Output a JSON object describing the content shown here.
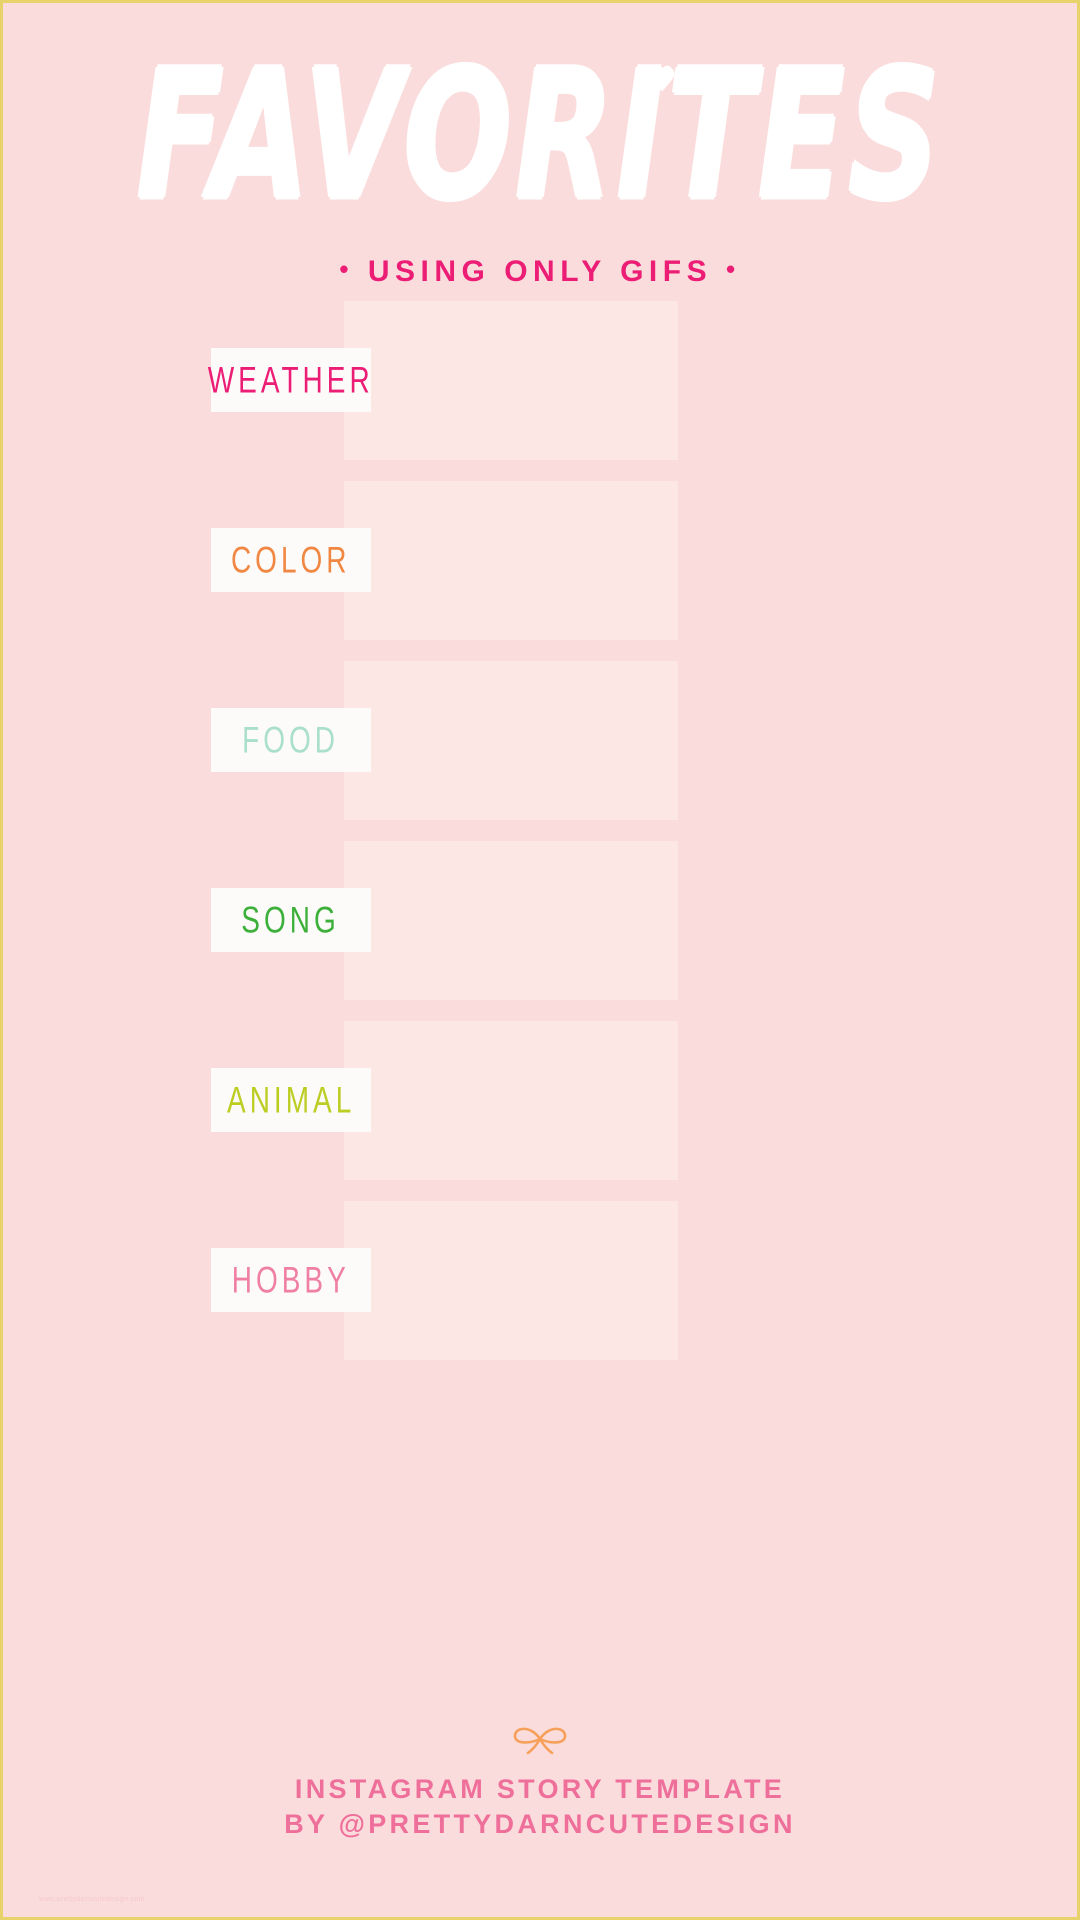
{
  "page": {
    "background_color": "#fbdcdc",
    "border_color": "#e8d36a",
    "panel_color": "#fce7e5",
    "label_box_color": "#fdfbfa"
  },
  "header": {
    "title": "FAVORITES",
    "title_color": "#ffffff",
    "heart_icon": "♥",
    "subtitle_prefix": "•",
    "subtitle": "USING ONLY GIFS",
    "subtitle_suffix": "•",
    "subtitle_color": "#ec1d75"
  },
  "rows": [
    {
      "label": "WEATHER",
      "color": "#ec1d75"
    },
    {
      "label": "COLOR",
      "color": "#f08742"
    },
    {
      "label": "FOOD",
      "color": "#a9dfcb"
    },
    {
      "label": "SONG",
      "color": "#3cb03a"
    },
    {
      "label": "ANIMAL",
      "color": "#bccd24"
    },
    {
      "label": "HOBBY",
      "color": "#ef7fa5"
    }
  ],
  "footer": {
    "bow_icon": "bow-icon",
    "bow_color": "#f6a05a",
    "line1": "INSTAGRAM STORY TEMPLATE",
    "line2": "BY @PRETTYDARNCUTEDESIGN",
    "text_color": "#ef6f9b",
    "watermark": "www.prettydarncutedesign.com"
  }
}
